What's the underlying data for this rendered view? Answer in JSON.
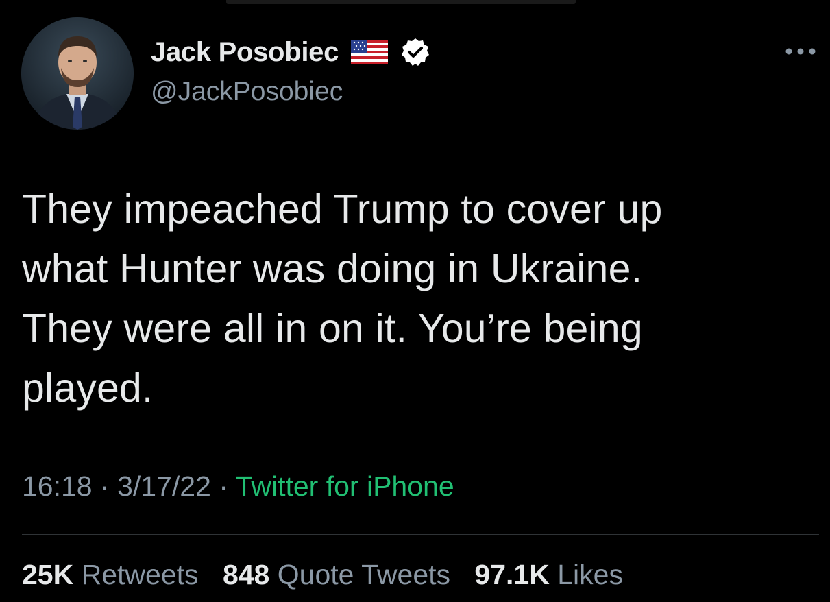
{
  "author": {
    "display_name": "Jack Posobiec",
    "handle": "@JackPosobiec",
    "flag_icon": "us-flag-icon",
    "verified_icon": "verified-badge-icon"
  },
  "tweet": {
    "text": "They impeached Trump to cover up\nwhat Hunter was doing in Ukraine.\nThey were all in on it. You’re being\nplayed."
  },
  "meta": {
    "time": "16:18",
    "separator": "·",
    "date": "3/17/22",
    "source": "Twitter for iPhone"
  },
  "stats": {
    "retweets_count": "25K",
    "retweets_label": "Retweets",
    "quotes_count": "848",
    "quotes_label": "Quote Tweets",
    "likes_count": "97.1K",
    "likes_label": "Likes"
  },
  "colors": {
    "background": "#000000",
    "text": "#e7e9ea",
    "secondary": "#8b98a5",
    "source_link": "#21bf73"
  }
}
